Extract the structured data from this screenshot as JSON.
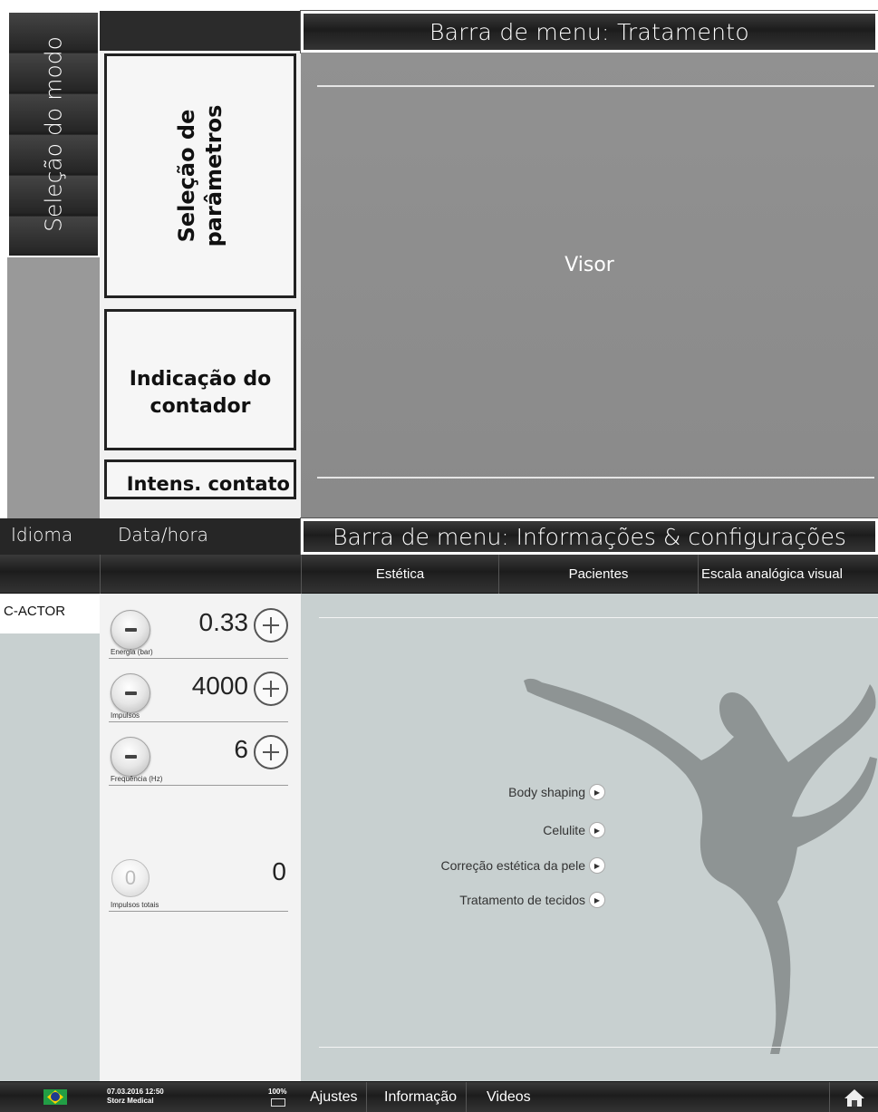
{
  "diagram": {
    "mode_selection": "Seleção do modo",
    "parameter_selection_line1": "Seleção de",
    "parameter_selection_line2": "parâmetros",
    "counter_line1": "Indicação do",
    "counter_line2": "contador",
    "contact_intensity": "Intens. contato",
    "top_menu_bar": "Barra de menu: Tratamento",
    "display": "Visor",
    "language": "Idioma",
    "date_time": "Data/hora",
    "bottom_menu_bar": "Barra de menu: Informações & configurações"
  },
  "screen": {
    "tabs": [
      "Estética",
      "Pacientes",
      "Escala analógica visual"
    ],
    "mode": "C-ACTOR",
    "parameters": [
      {
        "label": "Energia (bar)",
        "value": "0.33"
      },
      {
        "label": "Impulsos",
        "value": "4000"
      },
      {
        "label": "Frequência (Hz)",
        "value": "6"
      }
    ],
    "total": {
      "label": "Impulsos totais",
      "value": "0",
      "reset_glyph": "0"
    },
    "treatments": [
      "Body shaping",
      "Celulite",
      "Correção estética da pele",
      "Tratamento de tecidos"
    ],
    "status": {
      "datetime": "07.03.2016 12:50",
      "company": "Storz Medical",
      "battery": "100%"
    },
    "menu": [
      "Ajustes",
      "Informação",
      "Videos"
    ],
    "icons": {
      "flag": "brazil-flag-icon",
      "battery": "battery-charging-icon",
      "home": "home-icon",
      "arrow": "play-arrow-icon"
    },
    "colors": {
      "panel_background": "#c8d0d0",
      "bar_dark": "#222222",
      "silhouette": "#8a8f8f"
    }
  }
}
